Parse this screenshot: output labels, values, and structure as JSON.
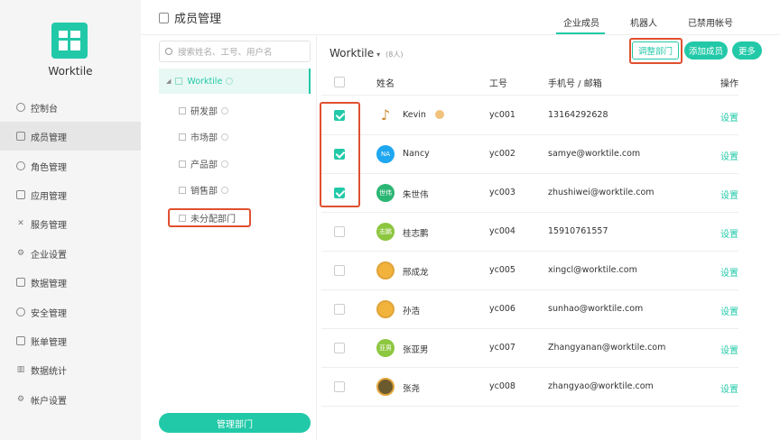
{
  "app": {
    "brand": "Worktile"
  },
  "nav": {
    "items": [
      {
        "label": "控制台",
        "icon": "dashboard-icon"
      },
      {
        "label": "成员管理",
        "icon": "members-icon"
      },
      {
        "label": "角色管理",
        "icon": "roles-icon"
      },
      {
        "label": "应用管理",
        "icon": "apps-icon"
      },
      {
        "label": "服务管理",
        "icon": "services-icon"
      },
      {
        "label": "企业设置",
        "icon": "gear-icon"
      },
      {
        "label": "数据管理",
        "icon": "data-icon"
      },
      {
        "label": "安全管理",
        "icon": "shield-icon"
      },
      {
        "label": "账单管理",
        "icon": "bill-icon"
      },
      {
        "label": "数据统计",
        "icon": "stats-icon"
      },
      {
        "label": "帐户设置",
        "icon": "gear-icon"
      }
    ],
    "active_index": 1
  },
  "header": {
    "title": "成员管理",
    "tabs": [
      "企业成员",
      "机器人",
      "已禁用帐号"
    ],
    "active_tab": 0
  },
  "tree": {
    "search_placeholder": "搜索姓名、工号、用户名",
    "root": "Worktile",
    "children": [
      "研发部",
      "市场部",
      "产品部",
      "销售部",
      "未分配部门"
    ],
    "manage_button": "管理部门"
  },
  "content": {
    "org_name": "Worktile",
    "member_count": "(8人)",
    "buttons": {
      "adjust": "调整部门",
      "add": "添加成员",
      "more": "更多"
    },
    "columns": [
      "姓名",
      "工号",
      "手机号 / 邮箱",
      "操作"
    ],
    "rows": [
      {
        "name": "Kevin",
        "avatar": "",
        "avatar_color": "#ffffff",
        "id": "yc001",
        "contact": "13164292628",
        "action": "设置",
        "checked": true,
        "admin": true
      },
      {
        "name": "Nancy",
        "avatar": "NA",
        "avatar_color": "#1ea7f0",
        "id": "yc002",
        "contact": "samye@worktile.com",
        "action": "设置",
        "checked": true
      },
      {
        "name": "朱世伟",
        "avatar": "世伟",
        "avatar_color": "#2bb673",
        "id": "yc003",
        "contact": "zhushiwei@worktile.com",
        "action": "设置",
        "checked": true
      },
      {
        "name": "桂志鹏",
        "avatar": "志鹏",
        "avatar_color": "#8dc63f",
        "id": "yc004",
        "contact": "15910761557",
        "action": "设置",
        "checked": false
      },
      {
        "name": "邢成龙",
        "avatar": "",
        "avatar_color": "#f2b33d",
        "id": "yc005",
        "contact": "xingcl@worktile.com",
        "action": "设置",
        "checked": false
      },
      {
        "name": "孙浩",
        "avatar": "",
        "avatar_color": "#f2b33d",
        "id": "yc006",
        "contact": "sunhao@worktile.com",
        "action": "设置",
        "checked": false
      },
      {
        "name": "张亚男",
        "avatar": "亚男",
        "avatar_color": "#8dc63f",
        "id": "yc007",
        "contact": "Zhangyanan@worktile.com",
        "action": "设置",
        "checked": false
      },
      {
        "name": "张尧",
        "avatar": "",
        "avatar_color": "#6b5a2e",
        "id": "yc008",
        "contact": "zhangyao@worktile.com",
        "action": "设置",
        "checked": false
      }
    ]
  },
  "colors": {
    "accent": "#22c9a8",
    "highlight": "#e0502f"
  }
}
